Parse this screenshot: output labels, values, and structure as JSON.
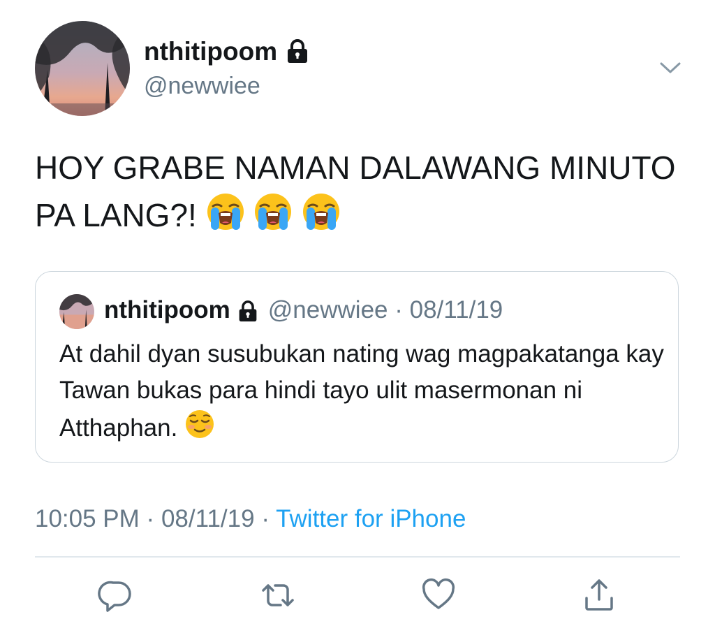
{
  "tweet": {
    "display_name": "nthitipoom",
    "handle": "@newwiee",
    "text": "HOY GRABE NAMAN DALAWANG MINUTO PA LANG?!",
    "emojis": [
      "loudly-crying-face",
      "loudly-crying-face",
      "loudly-crying-face"
    ],
    "time": "10:05 PM",
    "date": "08/11/19",
    "source": "Twitter for iPhone"
  },
  "quoted": {
    "display_name": "nthitipoom",
    "handle": "@newwiee",
    "date": "08/11/19",
    "text": "At dahil dyan susubukan nating wag magpakatanga kay Tawan bukas para hindi tayo ulit masermonan ni Atthaphan.",
    "emoji": "smiling-face"
  },
  "icons": {
    "protected": "lock-icon",
    "more": "chevron-down-icon",
    "reply": "reply-icon",
    "retweet": "retweet-icon",
    "like": "heart-icon",
    "share": "share-icon"
  },
  "colors": {
    "text": "#14171a",
    "secondary": "#657786",
    "link": "#1da1f2",
    "border": "#ccd6dd"
  }
}
